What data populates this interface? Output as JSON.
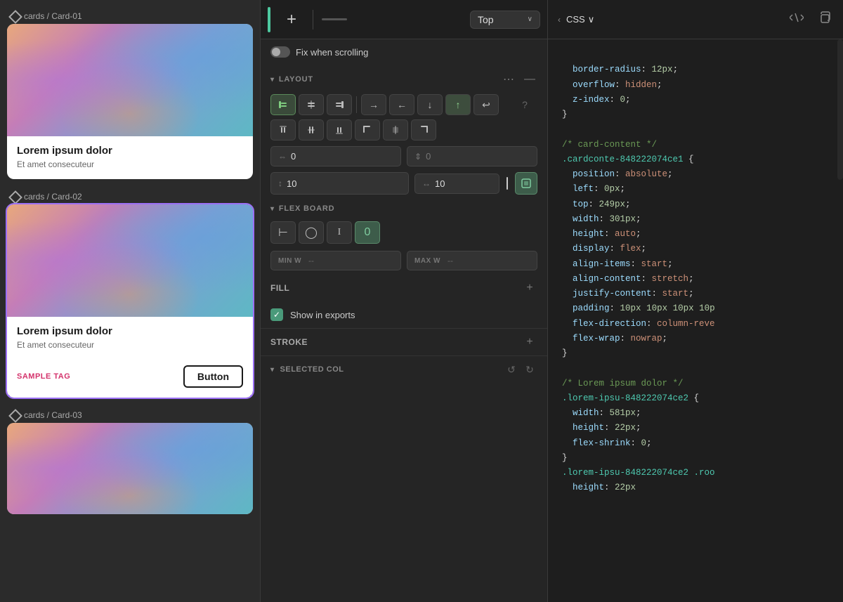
{
  "left_panel": {
    "card1": {
      "label": "cards / Card-01",
      "title": "Lorem ipsum dolor",
      "subtitle": "Et amet consecuteur"
    },
    "card2": {
      "label": "cards / Card-02",
      "title": "Lorem ipsum dolor",
      "subtitle": "Et amet consecuteur",
      "tag": "SAMPLE TAG",
      "button": "Button"
    },
    "card3": {
      "label": "cards / Card-03"
    }
  },
  "middle_panel": {
    "position_dropdown": {
      "label": "Top",
      "placeholder": "Top"
    },
    "fix_scrolling_label": "Fix when scrolling",
    "layout_section": {
      "title": "LAYOUT"
    },
    "inputs": {
      "gap_value": "0",
      "gap_placeholder": "0",
      "padding_h": "10",
      "padding_v": "10"
    },
    "flex_board": {
      "title": "FLEX BOARD"
    },
    "min_w": {
      "label": "MIN W",
      "value": "--"
    },
    "max_w": {
      "label": "MAX W",
      "value": "--"
    },
    "fill_section": {
      "title": "FILL"
    },
    "show_exports": {
      "label": "Show in exports",
      "checked": true
    },
    "stroke_section": {
      "title": "STROKE"
    },
    "selected_col": {
      "title": "SELECTED COL"
    }
  },
  "right_panel": {
    "header": {
      "css_label": "CSS",
      "chevron": "‹",
      "dropdown_arrow": "∨"
    },
    "code": {
      "lines": [
        "border-radius: 12px;",
        "overflow: hidden;",
        "z-index: 0;",
        "}",
        "",
        "/* card-content */",
        ".cardconte-848222074ce1 {",
        "  position: absolute;",
        "  left: 0px;",
        "  top: 249px;",
        "  width: 301px;",
        "  height: auto;",
        "  display: flex;",
        "  align-items: start;",
        "  align-content: stretch;",
        "  justify-content: start;",
        "  padding: 10px 10px 10px 10p",
        "  flex-direction: column-reve",
        "  flex-wrap: nowrap;",
        "}",
        "",
        "/* Lorem ipsum dolor */",
        ".lorem-ipsu-848222074ce2 {",
        "  width: 581px;",
        "  height: 22px;",
        "  flex-shrink: 0;",
        "}",
        ".lorem-ipsu-848222074ce2 .roo",
        "  height: 22px"
      ]
    }
  }
}
